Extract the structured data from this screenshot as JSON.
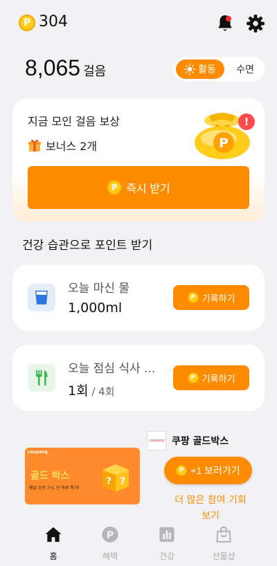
{
  "header": {
    "coin_glyph": "P",
    "points": "304",
    "icons": [
      "bell-icon",
      "gear-icon"
    ],
    "notification_dot_color": "#ff2d2d"
  },
  "steps": {
    "value": "8,065",
    "unit": "걸음"
  },
  "mode_toggle": {
    "active": "활동",
    "inactive": "수면"
  },
  "reward_card": {
    "title": "지금 모인 걸음 보상",
    "bonus": "보너스 2개",
    "alert": "!",
    "claim_button": "즉시 받기"
  },
  "section_title": "건강 습관으로 포인트 받기",
  "habits": [
    {
      "name": "오늘 마신 물",
      "value": "1,000ml",
      "total": "",
      "button": "기록하기",
      "icon": "water-cup-icon"
    },
    {
      "name": "오늘 점심 식사 ...",
      "value": "1회",
      "total": " / 4회",
      "button": "기록하기",
      "icon": "fork-knife-icon"
    }
  ],
  "ad": {
    "logo_text": "coupang",
    "title": "쿠팡 골드박스",
    "subtitle": "",
    "banner_brand": "coupang",
    "banner_head": "골드 박스",
    "banner_small": "매일 오전 7시, 단 하루 특가!",
    "more_points_button": "+1 보러가기",
    "more_link": "더 많은 참여 기회 보기"
  },
  "tabs": [
    {
      "label": "홈",
      "icon": "home-icon",
      "active": true
    },
    {
      "label": "혜택",
      "icon": "points-icon",
      "active": false
    },
    {
      "label": "건강",
      "icon": "chart-icon",
      "active": false
    },
    {
      "label": "선물샵",
      "icon": "shopping-bag-icon",
      "active": false
    }
  ],
  "colors": {
    "accent": "#ff8c00",
    "coin": "#ffcc1a",
    "background": "#f2f2f4"
  }
}
